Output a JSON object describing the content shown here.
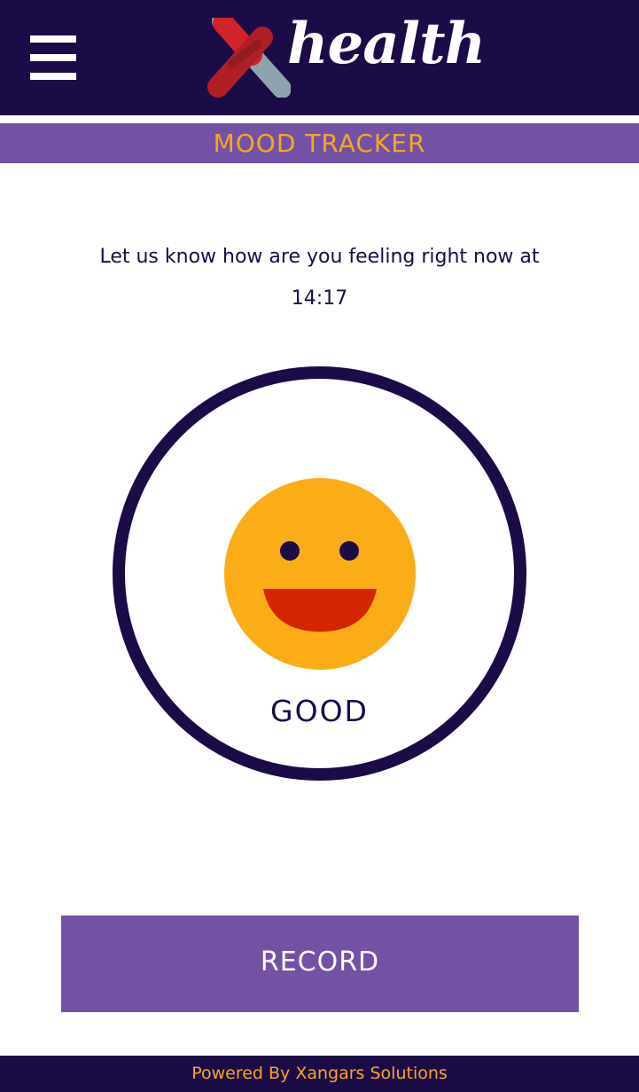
{
  "header": {
    "menu_icon": "hamburger-menu-icon",
    "logo_text": "health",
    "logo_icon": "x-mark-logo-icon"
  },
  "page": {
    "title": "MOOD TRACKER"
  },
  "prompt": {
    "text": "Let us know how are you feeling right now at",
    "time": "14:17"
  },
  "mood": {
    "icon": "smiley-face-icon",
    "label": "GOOD"
  },
  "actions": {
    "record_label": "RECORD"
  },
  "footer": {
    "text": "Powered By Xangars Solutions"
  },
  "colors": {
    "navy": "#1b0b47",
    "purple": "#7352a5",
    "orange": "#f9a620",
    "face_yellow": "#fbad18",
    "mouth_red": "#d52400",
    "logo_red": "#d1232a",
    "logo_gray": "#8ea3ae"
  }
}
